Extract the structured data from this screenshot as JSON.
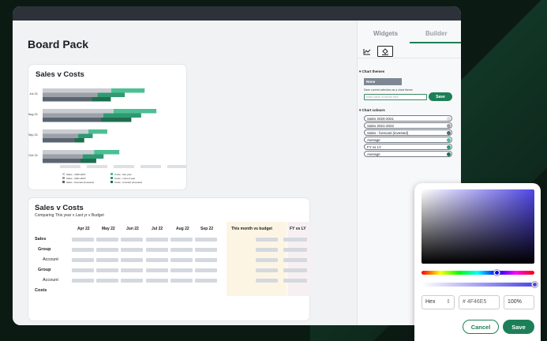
{
  "page": {
    "title": "Board Pack"
  },
  "sales_costs_chart": {
    "title": "Sales v Costs",
    "legend": [
      {
        "label": "Sales - 2020-2021",
        "color": "#c9ccd1"
      },
      {
        "label": "Costs - last year",
        "color": "#4cbf94"
      },
      {
        "label": "Sales - 2021-2022",
        "color": "#9ca1a8"
      },
      {
        "label": "Costs - current year",
        "color": "#2e9a72"
      },
      {
        "label": "Sales - forecast (invested)",
        "color": "#5b6572"
      },
      {
        "label": "Costs - forecast (invested)",
        "color": "#1d6e4f"
      }
    ]
  },
  "chart_data": {
    "type": "bar",
    "orientation": "horizontal",
    "title": "Sales v Costs",
    "categories": [
      "Jul 21",
      "Aug 21",
      "Sep 21",
      "Oct 21"
    ],
    "series": [
      {
        "name": "Sales - 2020-2021",
        "values": [
          60,
          62,
          40,
          45
        ]
      },
      {
        "name": "Sales - 2021-2022",
        "values": [
          55,
          60,
          38,
          42
        ]
      },
      {
        "name": "Sales - forecast (invested)",
        "values": [
          50,
          58,
          35,
          40
        ]
      },
      {
        "name": "Costs - last year",
        "values": [
          53,
          68,
          30,
          40
        ]
      },
      {
        "name": "Costs - current year",
        "values": [
          43,
          60,
          23,
          33
        ]
      },
      {
        "name": "Costs - forecast (invested)",
        "values": [
          30,
          48,
          15,
          25
        ]
      }
    ],
    "grid": false,
    "legend_position": "bottom"
  },
  "sales_table": {
    "title": "Sales v Costs",
    "subtitle": "Comparing This year v Last yr v Budget",
    "columns": [
      "Apr 22",
      "May 22",
      "Jun 22",
      "Jul 22",
      "Aug 22",
      "Sep 22",
      "This month vs budget",
      "FY vs LY"
    ],
    "rows": [
      {
        "label": "Sales",
        "bold": true
      },
      {
        "label": "Group",
        "bold": true
      },
      {
        "label": "Account",
        "bold": false
      },
      {
        "label": "Group",
        "bold": true
      },
      {
        "label": "Account",
        "bold": false
      },
      {
        "label": "Costs",
        "bold": true
      }
    ]
  },
  "panel": {
    "tabs": [
      "Widgets",
      "Builder"
    ],
    "chart_themes_label": "Chart themes",
    "theme_selected": "None",
    "save_hint": "Save current selection as a chart theme",
    "name_placeholder": "Enter name of theme here",
    "save_label": "Save",
    "chart_colours_label": "Chart colours",
    "colours": [
      {
        "label": "Sales 2020-2021",
        "color": "#d7dadd"
      },
      {
        "label": "Sales 2021-2022",
        "color": "#9aa0a6"
      },
      {
        "label": "Sales - forecast (invested)",
        "color": "#5b6572"
      },
      {
        "label": "Average",
        "color": "#4cbf94"
      },
      {
        "label": "FY vs LY",
        "color": "#2e9a72"
      },
      {
        "label": "Average",
        "color": "#1d6e4f"
      }
    ]
  },
  "color_picker": {
    "format": "Hex",
    "hex_value": "# 4F46E5",
    "opacity": "100%",
    "cancel_label": "Cancel",
    "save_label": "Save",
    "selected_color": "#4F46E5",
    "hue_position": 0.67,
    "alpha": 1.0
  }
}
